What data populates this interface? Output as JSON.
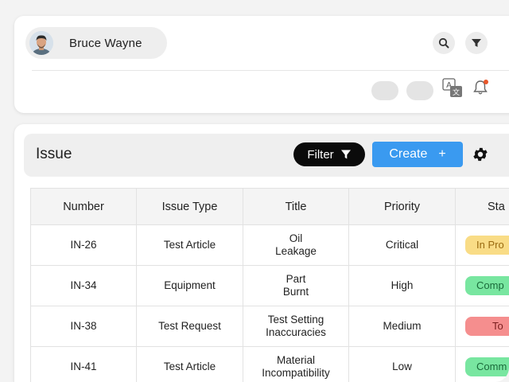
{
  "header": {
    "user_name": "Bruce Wayne",
    "icons": [
      "search-icon",
      "filter-icon",
      "translate-icon",
      "bell-icon"
    ]
  },
  "issue": {
    "title": "Issue",
    "filter_label": "Filter",
    "create_label": "Create",
    "create_plus": "+"
  },
  "table": {
    "columns": [
      "Number",
      "Issue Type",
      "Title",
      "Priority",
      "Sta"
    ],
    "rows": [
      {
        "number": "IN-26",
        "type": "Test Article",
        "title1": "Oil",
        "title2": "Leakage",
        "priority": "Critical",
        "status": "In Pro",
        "status_color": "#f9dc86",
        "status_text_color": "#9a6a10"
      },
      {
        "number": "IN-34",
        "type": "Equipment",
        "title1": "Part",
        "title2": "Burnt",
        "priority": "High",
        "status": "Comp",
        "status_color": "#78e6a0",
        "status_text_color": "#1a6a3a"
      },
      {
        "number": "IN-38",
        "type": "Test Request",
        "title1": "Test Setting",
        "title2": "Inaccuracies",
        "priority": "Medium",
        "status": "To",
        "status_color": "#f58e8e",
        "status_text_color": "#7a1e1e"
      },
      {
        "number": "IN-41",
        "type": "Test Article",
        "title1": "Material",
        "title2": "Incompatibility",
        "priority": "Low",
        "status": "Comm",
        "status_color": "#78e6a0",
        "status_text_color": "#1a6a3a"
      }
    ]
  },
  "colors": {
    "accent_blue": "#3a9af0",
    "filter_black": "#0b0b0b",
    "notification": "#e8562a"
  }
}
